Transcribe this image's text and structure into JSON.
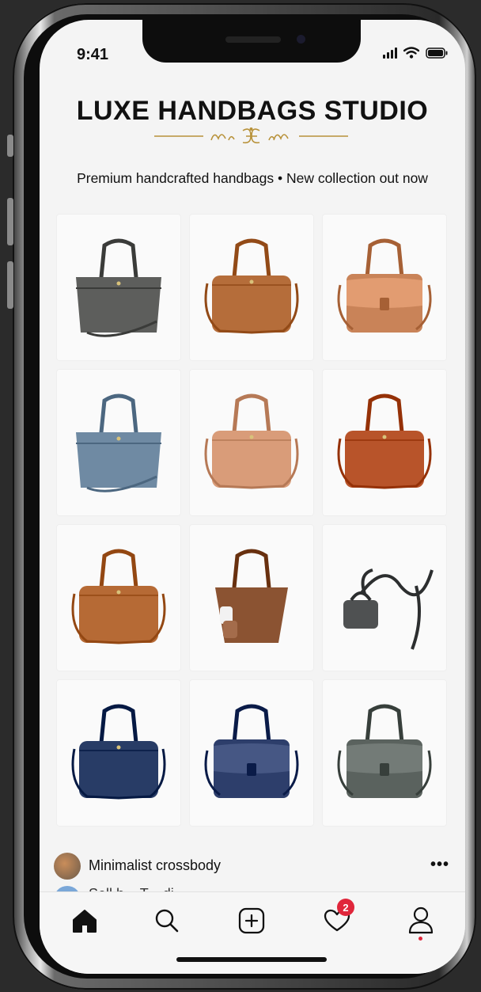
{
  "status_bar": {
    "time": "9:41"
  },
  "store": {
    "title": "LUXE HANDBAGS STUDIO",
    "subtitle": "Premium handcrafted handbags • New collection out now"
  },
  "products": [
    {
      "style": "tote",
      "color": "#5d5e5c",
      "icon": "gray-tote-bag"
    },
    {
      "style": "satchel",
      "color": "#b56d3a",
      "icon": "tan-satchel-bag"
    },
    {
      "style": "flap",
      "color": "#c98358",
      "icon": "tan-flap-bag"
    },
    {
      "style": "tote",
      "color": "#6f8aa3",
      "icon": "blue-tote-bag"
    },
    {
      "style": "satchel",
      "color": "#d99c79",
      "icon": "peach-satchel-bag"
    },
    {
      "style": "satchel",
      "color": "#b8542a",
      "icon": "rust-satchel-bag"
    },
    {
      "style": "satchel",
      "color": "#b66a35",
      "icon": "cognac-satchel-bag"
    },
    {
      "style": "bucket",
      "color": "#8b5332",
      "icon": "brown-tote-bag"
    },
    {
      "style": "crossbody",
      "color": "#4f5152",
      "icon": "gray-crossbody-bag"
    },
    {
      "style": "satchel",
      "color": "#283c66",
      "icon": "navy-satchel-bag"
    },
    {
      "style": "flap",
      "color": "#2d3e6b",
      "icon": "navy-flap-bag"
    },
    {
      "style": "flap",
      "color": "#5a625e",
      "icon": "green-flap-bag"
    }
  ],
  "feed": {
    "post_title": "Minimalist crossbody",
    "more_label": "•••",
    "next_post_partial": "Sell h... T... di..."
  },
  "tab_bar": {
    "items": [
      {
        "name": "home",
        "icon": "home-icon",
        "active": true
      },
      {
        "name": "search",
        "icon": "search-icon"
      },
      {
        "name": "create",
        "icon": "plus-square-icon"
      },
      {
        "name": "activity",
        "icon": "heart-icon",
        "badge": "2"
      },
      {
        "name": "profile",
        "icon": "profile-icon"
      }
    ]
  },
  "colors": {
    "accent_gold": "#b8923a",
    "badge_red": "#e0263b",
    "text": "#111111"
  }
}
